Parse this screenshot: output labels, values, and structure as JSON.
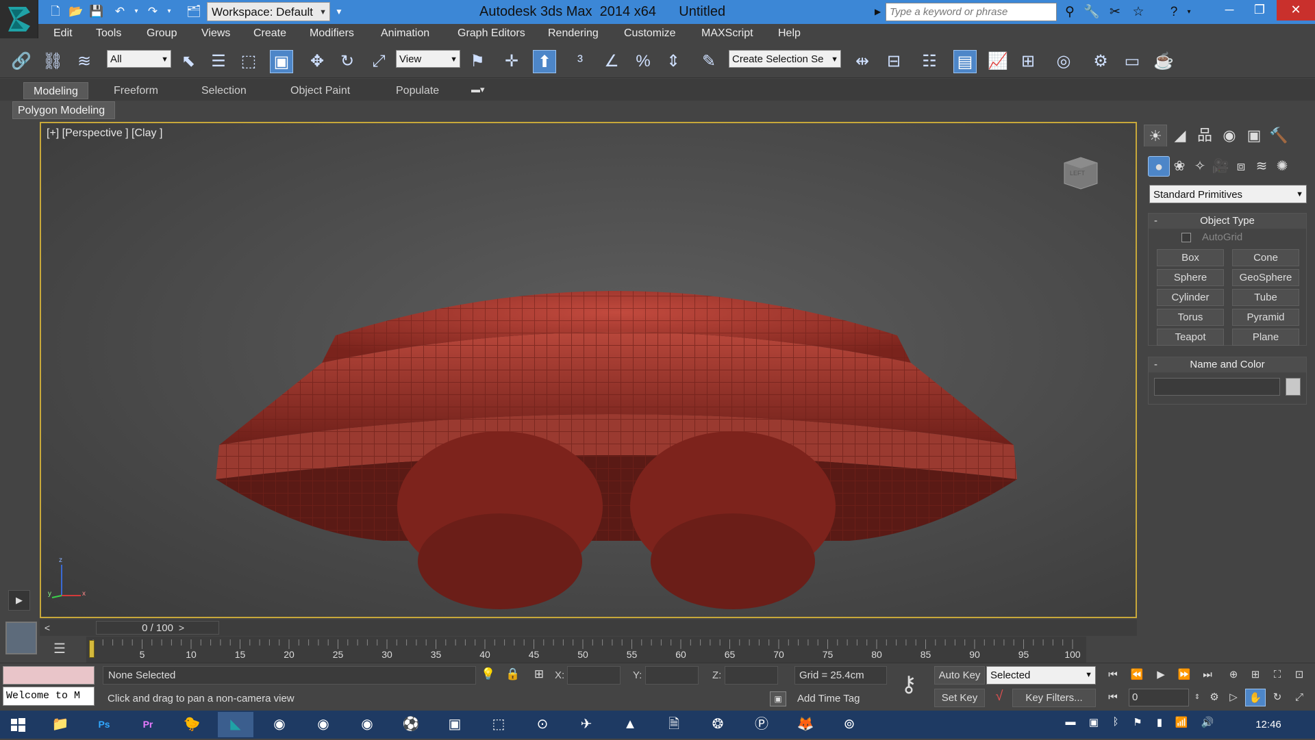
{
  "title_bar": {
    "workspace": "Workspace: Default",
    "title": "Autodesk 3ds Max  2014 x64      Untitled",
    "search_placeholder": "Type a keyword or phrase"
  },
  "menu": [
    "Edit",
    "Tools",
    "Group",
    "Views",
    "Create",
    "Modifiers",
    "Animation",
    "Graph Editors",
    "Rendering",
    "Customize",
    "MAXScript",
    "Help"
  ],
  "toolbar": {
    "filter": "All",
    "ref_coord": "View",
    "named_selection": "Create Selection Se"
  },
  "ribbon": {
    "tabs": [
      "Modeling",
      "Freeform",
      "Selection",
      "Object Paint",
      "Populate"
    ],
    "group": "Polygon Modeling"
  },
  "viewport": {
    "label": "[+] [Perspective ] [Clay ]",
    "viewcube_text": "LEFT",
    "axis": {
      "x": "x",
      "y": "y",
      "z": "z"
    }
  },
  "command_panel": {
    "category": "Standard Primitives",
    "object_type": {
      "title": "Object Type",
      "autogrid": "AutoGrid",
      "buttons": [
        "Box",
        "Cone",
        "Sphere",
        "GeoSphere",
        "Cylinder",
        "Tube",
        "Torus",
        "Pyramid",
        "Teapot",
        "Plane"
      ]
    },
    "name_color": {
      "title": "Name and Color"
    }
  },
  "time_slider": {
    "value": "0 / 100",
    "prev": "<",
    "next": ">"
  },
  "track_labels": [
    "5",
    "10",
    "15",
    "20",
    "25",
    "30",
    "35",
    "40",
    "45",
    "50",
    "55",
    "60",
    "65",
    "70",
    "75",
    "80",
    "85",
    "90",
    "95",
    "100"
  ],
  "status": {
    "listener": "Welcome to M",
    "selection": "None Selected",
    "prompt": "Click and drag to pan a non-camera view",
    "x_label": "X:",
    "y_label": "Y:",
    "z_label": "Z:",
    "grid": "Grid = 25.4cm",
    "add_time_tag": "Add Time Tag",
    "auto_key": "Auto Key",
    "set_key": "Set Key",
    "key_mode": "Selected",
    "key_filters": "Key Filters...",
    "frame": "0"
  },
  "taskbar": {
    "clock": "12:46",
    "ps": "Ps",
    "pr": "Pr"
  },
  "colors": {
    "accent": "#3c87d6",
    "viewport_border": "#c8a83a",
    "model": "#a33a2f"
  }
}
